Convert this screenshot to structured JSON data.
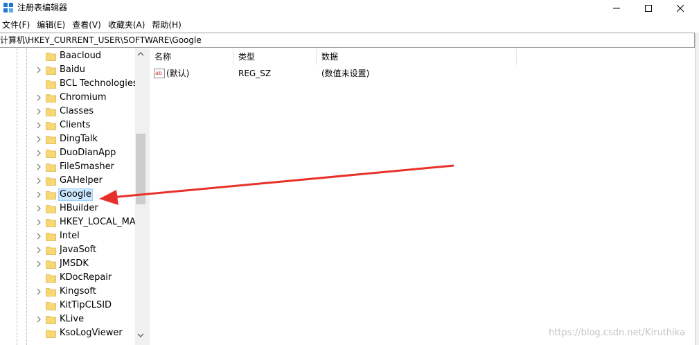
{
  "window": {
    "title": "注册表编辑器"
  },
  "menu": [
    "文件(F)",
    "编辑(E)",
    "查看(V)",
    "收藏夹(A)",
    "帮助(H)"
  ],
  "address": "计算机\\HKEY_CURRENT_USER\\SOFTWARE\\Google",
  "tree": {
    "items": [
      {
        "label": "Baacloud",
        "expandable": false
      },
      {
        "label": "Baidu",
        "expandable": true
      },
      {
        "label": "BCL Technologies",
        "expandable": false
      },
      {
        "label": "Chromium",
        "expandable": true
      },
      {
        "label": "Classes",
        "expandable": true
      },
      {
        "label": "Clients",
        "expandable": true
      },
      {
        "label": "DingTalk",
        "expandable": true
      },
      {
        "label": "DuoDianApp",
        "expandable": true
      },
      {
        "label": "FileSmasher",
        "expandable": true
      },
      {
        "label": "GAHelper",
        "expandable": true
      },
      {
        "label": "Google",
        "expandable": true,
        "selected": true
      },
      {
        "label": "HBuilder",
        "expandable": true
      },
      {
        "label": "HKEY_LOCAL_MAC",
        "expandable": true
      },
      {
        "label": "Intel",
        "expandable": true
      },
      {
        "label": "JavaSoft",
        "expandable": true
      },
      {
        "label": "JMSDK",
        "expandable": true
      },
      {
        "label": "KDocRepair",
        "expandable": false
      },
      {
        "label": "Kingsoft",
        "expandable": true
      },
      {
        "label": "KitTipCLSID",
        "expandable": false
      },
      {
        "label": "KLive",
        "expandable": true
      },
      {
        "label": "KsoLogViewer",
        "expandable": false
      }
    ]
  },
  "list": {
    "columns": [
      "名称",
      "类型",
      "数据"
    ],
    "rows": [
      {
        "name": "(默认)",
        "type": "REG_SZ",
        "data": "(数值未设置)"
      }
    ]
  },
  "watermark": "https://blog.csdn.net/Kiruthika",
  "colors": {
    "selection_bg": "#cce8ff",
    "arrow": "#e8302a",
    "folder": "#f8d775"
  }
}
